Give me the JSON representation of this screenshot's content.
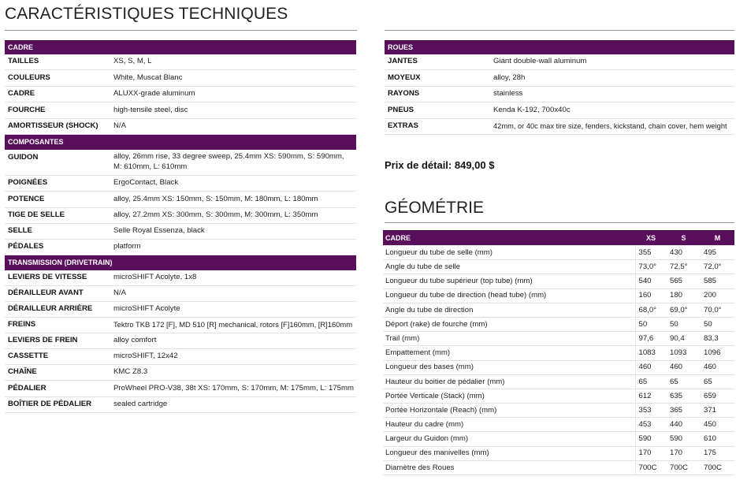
{
  "page_title": "CARACTÉRISTIQUES TECHNIQUES",
  "spec_sections": [
    {
      "heading": "CADRE",
      "rows": [
        {
          "label": "TAILLES",
          "value": "XS, S, M, L"
        },
        {
          "label": "COULEURS",
          "value": "White, Muscat Blanc"
        },
        {
          "label": "CADRE",
          "value": "ALUXX-grade aluminum"
        },
        {
          "label": "FOURCHE",
          "value": "high-tensile steel, disc"
        },
        {
          "label": "AMORTISSEUR (SHOCK)",
          "value": "N/A"
        }
      ]
    },
    {
      "heading": "COMPOSANTES",
      "rows": [
        {
          "label": "GUIDON",
          "value": "alloy, 26mm rise, 33 degree sweep, 25.4mm XS: 590mm, S: 590mm, M: 610mm, L: 610mm"
        },
        {
          "label": "POIGNÉES",
          "value": "ErgoContact, Black"
        },
        {
          "label": "POTENCE",
          "value": "alloy, 25.4mm XS: 150mm, S: 150mm, M: 180mm, L: 180mm"
        },
        {
          "label": "TIGE DE SELLE",
          "value": "alloy, 27.2mm XS: 300mm, S: 300mm, M: 300mm, L: 350mm"
        },
        {
          "label": "SELLE",
          "value": "Selle Royal Essenza, black"
        },
        {
          "label": "PÉDALES",
          "value": "platform"
        }
      ]
    },
    {
      "heading": "TRANSMISSION (DRIVETRAIN)",
      "rows": [
        {
          "label": "LEVIERS DE VITESSE",
          "value": "microSHIFT Acolyte, 1x8"
        },
        {
          "label": "DÉRAILLEUR AVANT",
          "value": "N/A"
        },
        {
          "label": "DÉRAILLEUR ARRIÈRE",
          "value": "microSHIFT Acolyte"
        },
        {
          "label": "FREINS",
          "value": "Tektro TKB 172 [F], MD 510 [R] mechanical, rotors [F]160mm, [R]160mm"
        },
        {
          "label": "LEVIERS DE FREIN",
          "value": "alloy comfort"
        },
        {
          "label": "CASSETTE",
          "value": "microSHIFT, 12x42"
        },
        {
          "label": "CHAÎNE",
          "value": "KMC Z8.3"
        },
        {
          "label": "PÉDALIER",
          "value": "ProWheel PRO-V38, 38t XS: 170mm, S: 170mm, M: 175mm, L: 175mm"
        },
        {
          "label": "BOÎTIER DE PÉDALIER",
          "value": "sealed cartridge"
        }
      ]
    }
  ],
  "wheels_section": {
    "heading": "ROUES",
    "rows": [
      {
        "label": "JANTES",
        "value": "Giant double-wall aluminum"
      },
      {
        "label": "MOYEUX",
        "value": "alloy, 28h"
      },
      {
        "label": "RAYONS",
        "value": "stainless"
      },
      {
        "label": "PNEUS",
        "value": "Kenda K-192, 700x40c"
      },
      {
        "label": "EXTRAS",
        "value": "42mm, or 40c max tire size, fenders, kickstand, chain cover, hem weight"
      }
    ]
  },
  "price_label": "Prix de détail: 849,00 $",
  "geometry": {
    "title": "GÉOMÉTRIE",
    "header": {
      "label": "CADRE",
      "sizes": [
        "XS",
        "S",
        "M"
      ]
    },
    "rows": [
      {
        "label": "Longueur du tube de selle (mm)",
        "values": [
          "355",
          "430",
          "495"
        ]
      },
      {
        "label": "Angle du tube de selle",
        "values": [
          "73,0°",
          "72,5°",
          "72,0°"
        ]
      },
      {
        "label": "Longueur du tube supérieur (top tube) (mm)",
        "values": [
          "540",
          "565",
          "585"
        ]
      },
      {
        "label": "Longueur du tube de direction (head tube) (mm)",
        "values": [
          "160",
          "180",
          "200"
        ]
      },
      {
        "label": "Angle du tube de direction",
        "values": [
          "68,0°",
          "69,0°",
          "70,0°"
        ]
      },
      {
        "label": "Déport (rake) de fourche (mm)",
        "values": [
          "50",
          "50",
          "50"
        ]
      },
      {
        "label": "Trail (mm)",
        "values": [
          "97,6",
          "90,4",
          "83,3"
        ]
      },
      {
        "label": "Empattement (mm)",
        "values": [
          "1083",
          "1093",
          "1096"
        ]
      },
      {
        "label": "Longueur des bases (mm)",
        "values": [
          "460",
          "460",
          "460"
        ]
      },
      {
        "label": "Hauteur du boitier de pédalier (mm)",
        "values": [
          "65",
          "65",
          "65"
        ]
      },
      {
        "label": "Portée Verticale (Stack) (mm)",
        "values": [
          "612",
          "635",
          "659"
        ]
      },
      {
        "label": "Portée Horizontale (Reach) (mm)",
        "values": [
          "353",
          "365",
          "371"
        ]
      },
      {
        "label": "Hauteur du cadre (mm)",
        "values": [
          "453",
          "440",
          "450"
        ]
      },
      {
        "label": "Largeur du Guidon (mm)",
        "values": [
          "590",
          "590",
          "610"
        ]
      },
      {
        "label": "Longueur des manivelles (mm)",
        "values": [
          "170",
          "170",
          "175"
        ]
      },
      {
        "label": "Diamètre des Roues",
        "values": [
          "700C",
          "700C",
          "700C"
        ]
      }
    ]
  }
}
